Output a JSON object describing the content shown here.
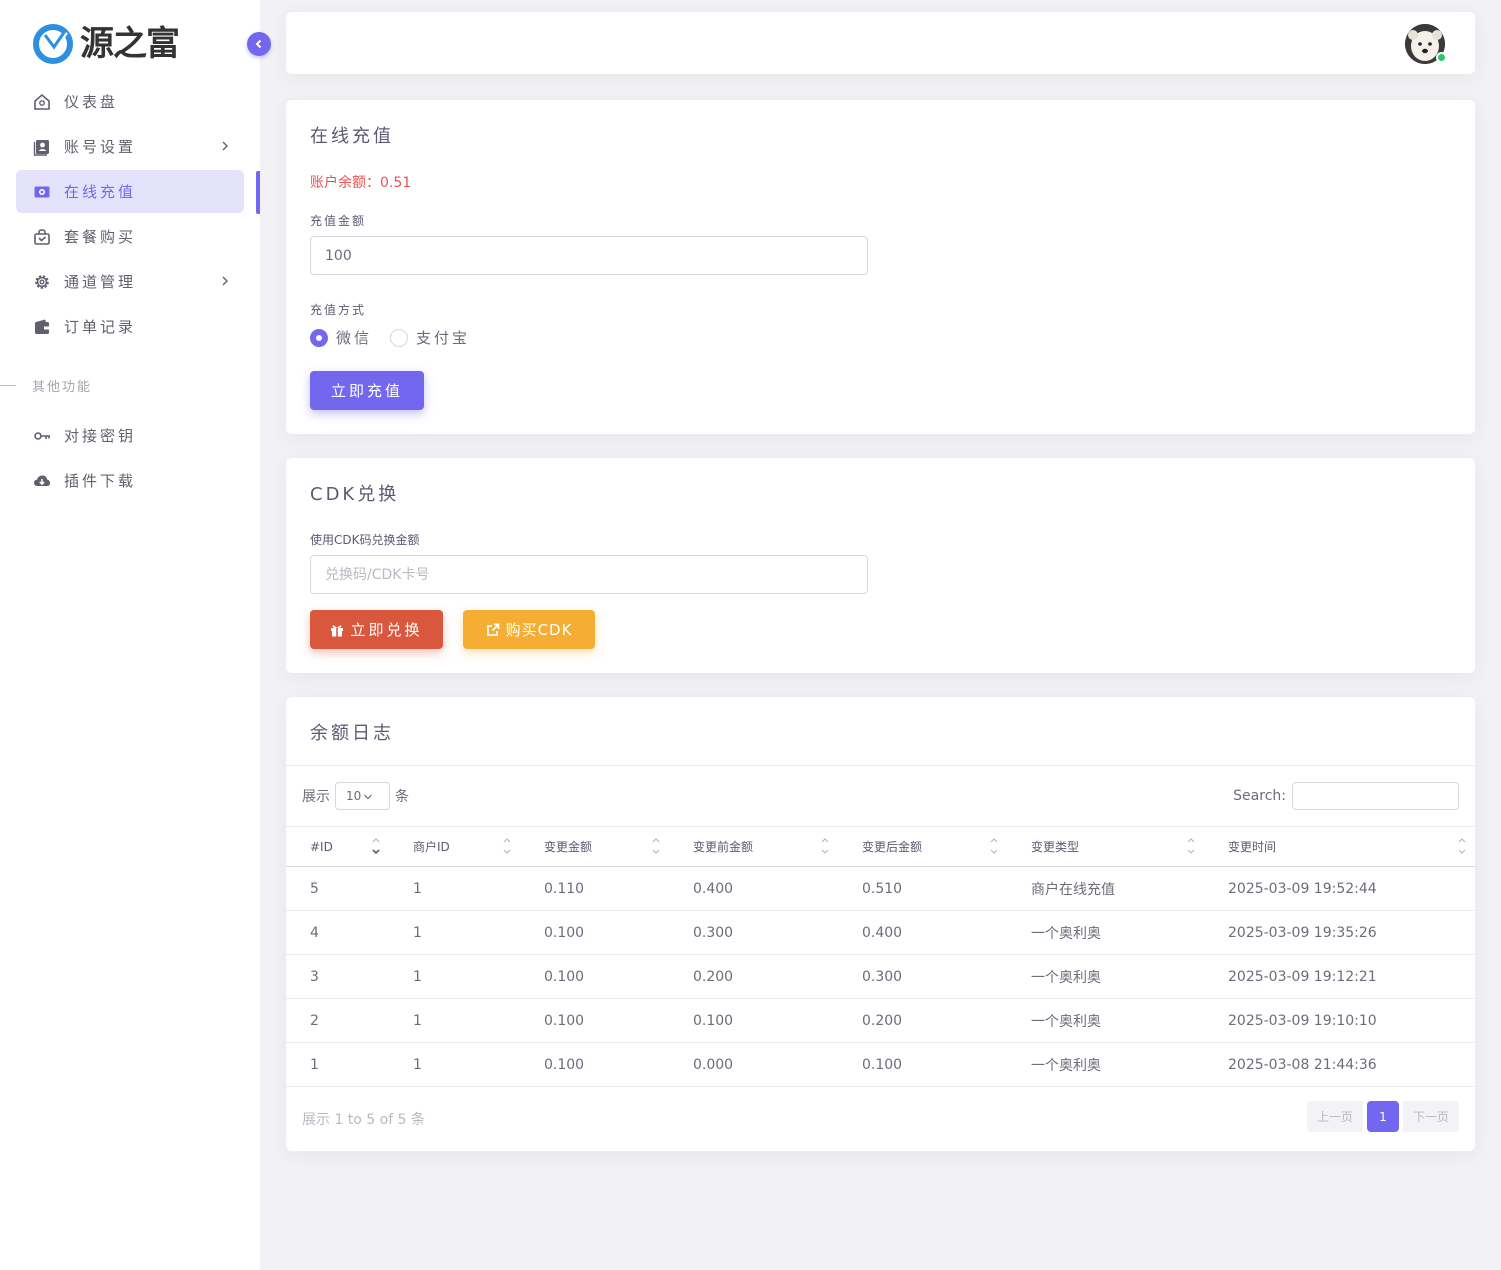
{
  "brand": {
    "logo_text": "源之富",
    "accent": "#7367f0"
  },
  "sidebar": {
    "items": [
      {
        "label": "仪表盘",
        "icon": "home-icon"
      },
      {
        "label": "账号设置",
        "icon": "user-card-icon"
      },
      {
        "label": "在线充值",
        "icon": "money-icon",
        "active": true
      },
      {
        "label": "套餐购买",
        "icon": "shopping-bag-icon"
      },
      {
        "label": "通道管理",
        "icon": "gear-icon"
      },
      {
        "label": "订单记录",
        "icon": "wallet-icon"
      }
    ],
    "section_label": "其他功能",
    "items2": [
      {
        "label": "对接密钥",
        "icon": "key-icon"
      },
      {
        "label": "插件下载",
        "icon": "cloud-download-icon"
      }
    ]
  },
  "recharge": {
    "title": "在线充值",
    "balance_text": "账户余额：0.51",
    "amount_label": "充值金额",
    "amount_value": "100",
    "method_label": "充值方式",
    "methods": [
      "微信",
      "支付宝"
    ],
    "selected_method": "微信",
    "submit_label": "立即充值"
  },
  "cdk": {
    "title": "CDK兑换",
    "field_label": "使用CDK码兑换金额",
    "placeholder": "兑换码/CDK卡号",
    "redeem_label": "立即兑换",
    "buy_label": "购买CDK"
  },
  "log": {
    "title": "余额日志",
    "show_prefix": "展示",
    "page_length": "10",
    "show_suffix": "条",
    "search_label": "Search:",
    "columns": [
      "#ID",
      "商户ID",
      "变更金额",
      "变更前金额",
      "变更后金额",
      "变更类型",
      "变更时间"
    ],
    "rows": [
      [
        "5",
        "1",
        "0.110",
        "0.400",
        "0.510",
        "商户在线充值",
        "2025-03-09 19:52:44"
      ],
      [
        "4",
        "1",
        "0.100",
        "0.300",
        "0.400",
        "一个奥利奥",
        "2025-03-09 19:35:26"
      ],
      [
        "3",
        "1",
        "0.100",
        "0.200",
        "0.300",
        "一个奥利奥",
        "2025-03-09 19:12:21"
      ],
      [
        "2",
        "1",
        "0.100",
        "0.100",
        "0.200",
        "一个奥利奥",
        "2025-03-09 19:10:10"
      ],
      [
        "1",
        "1",
        "0.100",
        "0.000",
        "0.100",
        "一个奥利奥",
        "2025-03-08 21:44:36"
      ]
    ],
    "info": "展示 1 to 5 of 5 条",
    "prev_label": "上一页",
    "current_page": "1",
    "next_label": "下一页"
  }
}
